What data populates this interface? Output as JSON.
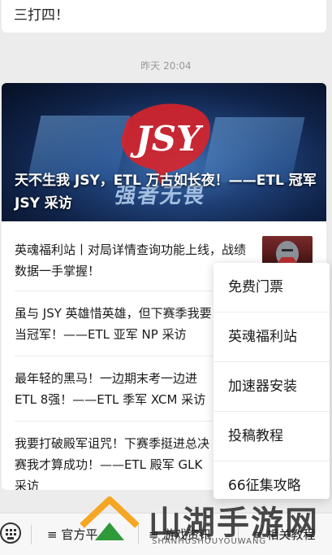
{
  "previous_message": {
    "text": "三打四！"
  },
  "timestamp": "昨天 20:04",
  "article": {
    "banner_headline": "天不生我 JSY，ETL 万古如长夜！——ETL 冠军 JSY 采访",
    "banner_logo_text": "JSY",
    "banner_stamp_text": "强者无畏",
    "items": [
      {
        "title": "英魂福利站丨对局详情查询功能上线，战绩数据一手掌握！"
      },
      {
        "title": "虽与 JSY 英雄惜英雄，但下赛季我要当冠军！——ETL 亚军 NP 采访"
      },
      {
        "title": "最年轻的黑马！一边期末考一边进ETL 8强！——ETL 季军 XCM 采访"
      },
      {
        "title": "我要打破殿军诅咒！下赛季挺进总决赛我才算成功！——ETL 殿军 GLK 采访"
      }
    ]
  },
  "popup_menu": {
    "items": [
      "免费门票",
      "英魂福利站",
      "加速器安装",
      "投稿教程",
      "66征集攻略"
    ]
  },
  "bottom_bar": {
    "keyboard_icon": "keyboard-icon",
    "menus": [
      "≡ 官方平",
      "≡ 游戏资讯",
      "≡ 相关教程"
    ]
  },
  "watermark": {
    "text": "山湖手游网",
    "subtext": "SHANHUSHOUYOUWANG"
  },
  "colors": {
    "background": "#ececec",
    "watermark_orange": "#f5a623",
    "watermark_green": "#2e9a3a",
    "logo_red": "#d8232a"
  }
}
